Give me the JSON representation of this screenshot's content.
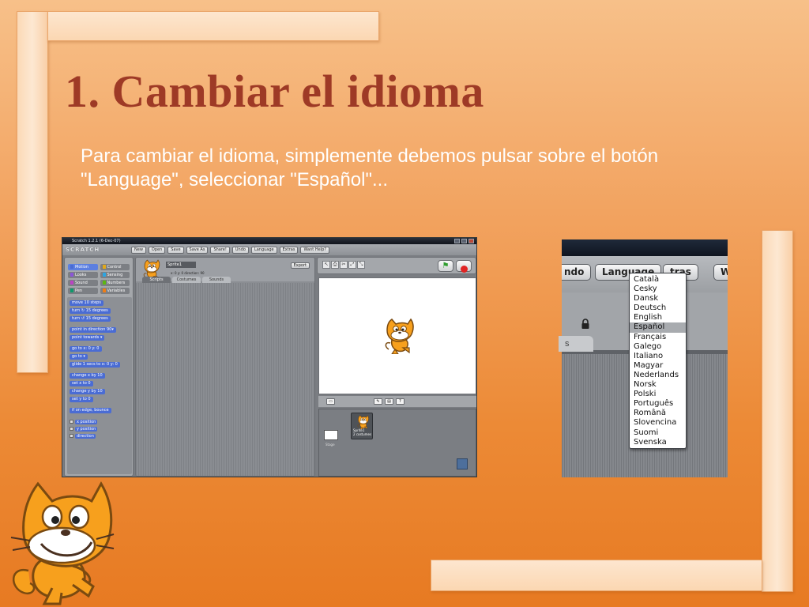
{
  "slide": {
    "title": "1. Cambiar el idioma",
    "body": "Para cambiar el idioma, simplemente debemos pulsar sobre el botón \"Language\", seleccionar \"Español\"..."
  },
  "scratch_window": {
    "title": "Scratch 1.2.1 (6-Dec-07)",
    "logo": "SCRATCH",
    "menu": [
      "New",
      "Open",
      "Save",
      "Save As",
      "Share!",
      "Undo",
      "Language",
      "Extras",
      "Want Help?"
    ],
    "categories": [
      {
        "label": "Motion",
        "color": "#4a6cd4"
      },
      {
        "label": "Control",
        "color": "#e1a91a"
      },
      {
        "label": "Looks",
        "color": "#8a55d7"
      },
      {
        "label": "Sensing",
        "color": "#2ca5e2"
      },
      {
        "label": "Sound",
        "color": "#bb42c3"
      },
      {
        "label": "Numbers",
        "color": "#5cb712"
      },
      {
        "label": "Pen",
        "color": "#0e9a6c"
      },
      {
        "label": "Variables",
        "color": "#ee7d16"
      }
    ],
    "blocks": [
      {
        "label": "move 10 steps",
        "gap": false
      },
      {
        "label": "turn ↻ 15 degrees",
        "gap": false
      },
      {
        "label": "turn ↺ 15 degrees",
        "gap": false
      },
      {
        "label": "point in direction 90▾",
        "gap": true
      },
      {
        "label": "point towards ▾",
        "gap": false
      },
      {
        "label": "go to x: 0 y: 0",
        "gap": true
      },
      {
        "label": "go to ▾",
        "gap": false
      },
      {
        "label": "glide 1 secs to x: 0 y: 0",
        "gap": false
      },
      {
        "label": "change x by 10",
        "gap": true
      },
      {
        "label": "set x to 0",
        "gap": false
      },
      {
        "label": "change y by 10",
        "gap": false
      },
      {
        "label": "set y to 0",
        "gap": false
      },
      {
        "label": "if on edge, bounce",
        "gap": true
      }
    ],
    "reporters": [
      "x position",
      "y position",
      "direction"
    ],
    "sprite_name": "Sprite1",
    "sprite_meta": "x: 0    y: 0    direction: 90",
    "export_label": "Export",
    "tabs": [
      "Scripts",
      "Costumes",
      "Sounds"
    ],
    "stage_label": "Stage",
    "sprite_card_label": "Sprite1",
    "sprite_card_sub": "2 costumes"
  },
  "language_menu": {
    "buttons": [
      "ndo",
      "Language",
      "tras",
      "W"
    ],
    "tab_fragment": "s",
    "items": [
      "Català",
      "Cesky",
      "Dansk",
      "Deutsch",
      "English",
      "Español",
      "Français",
      "Galego",
      "Italiano",
      "Magyar",
      "Nederlands",
      "Norsk",
      "Polski",
      "Português",
      "Română",
      "Slovencina",
      "Suomi",
      "Svenska"
    ],
    "selected": "Español"
  },
  "colors": {
    "title": "#9e3a26",
    "body_text": "#ffffff",
    "background_top": "#f7c089",
    "background_bottom": "#e77a22"
  }
}
